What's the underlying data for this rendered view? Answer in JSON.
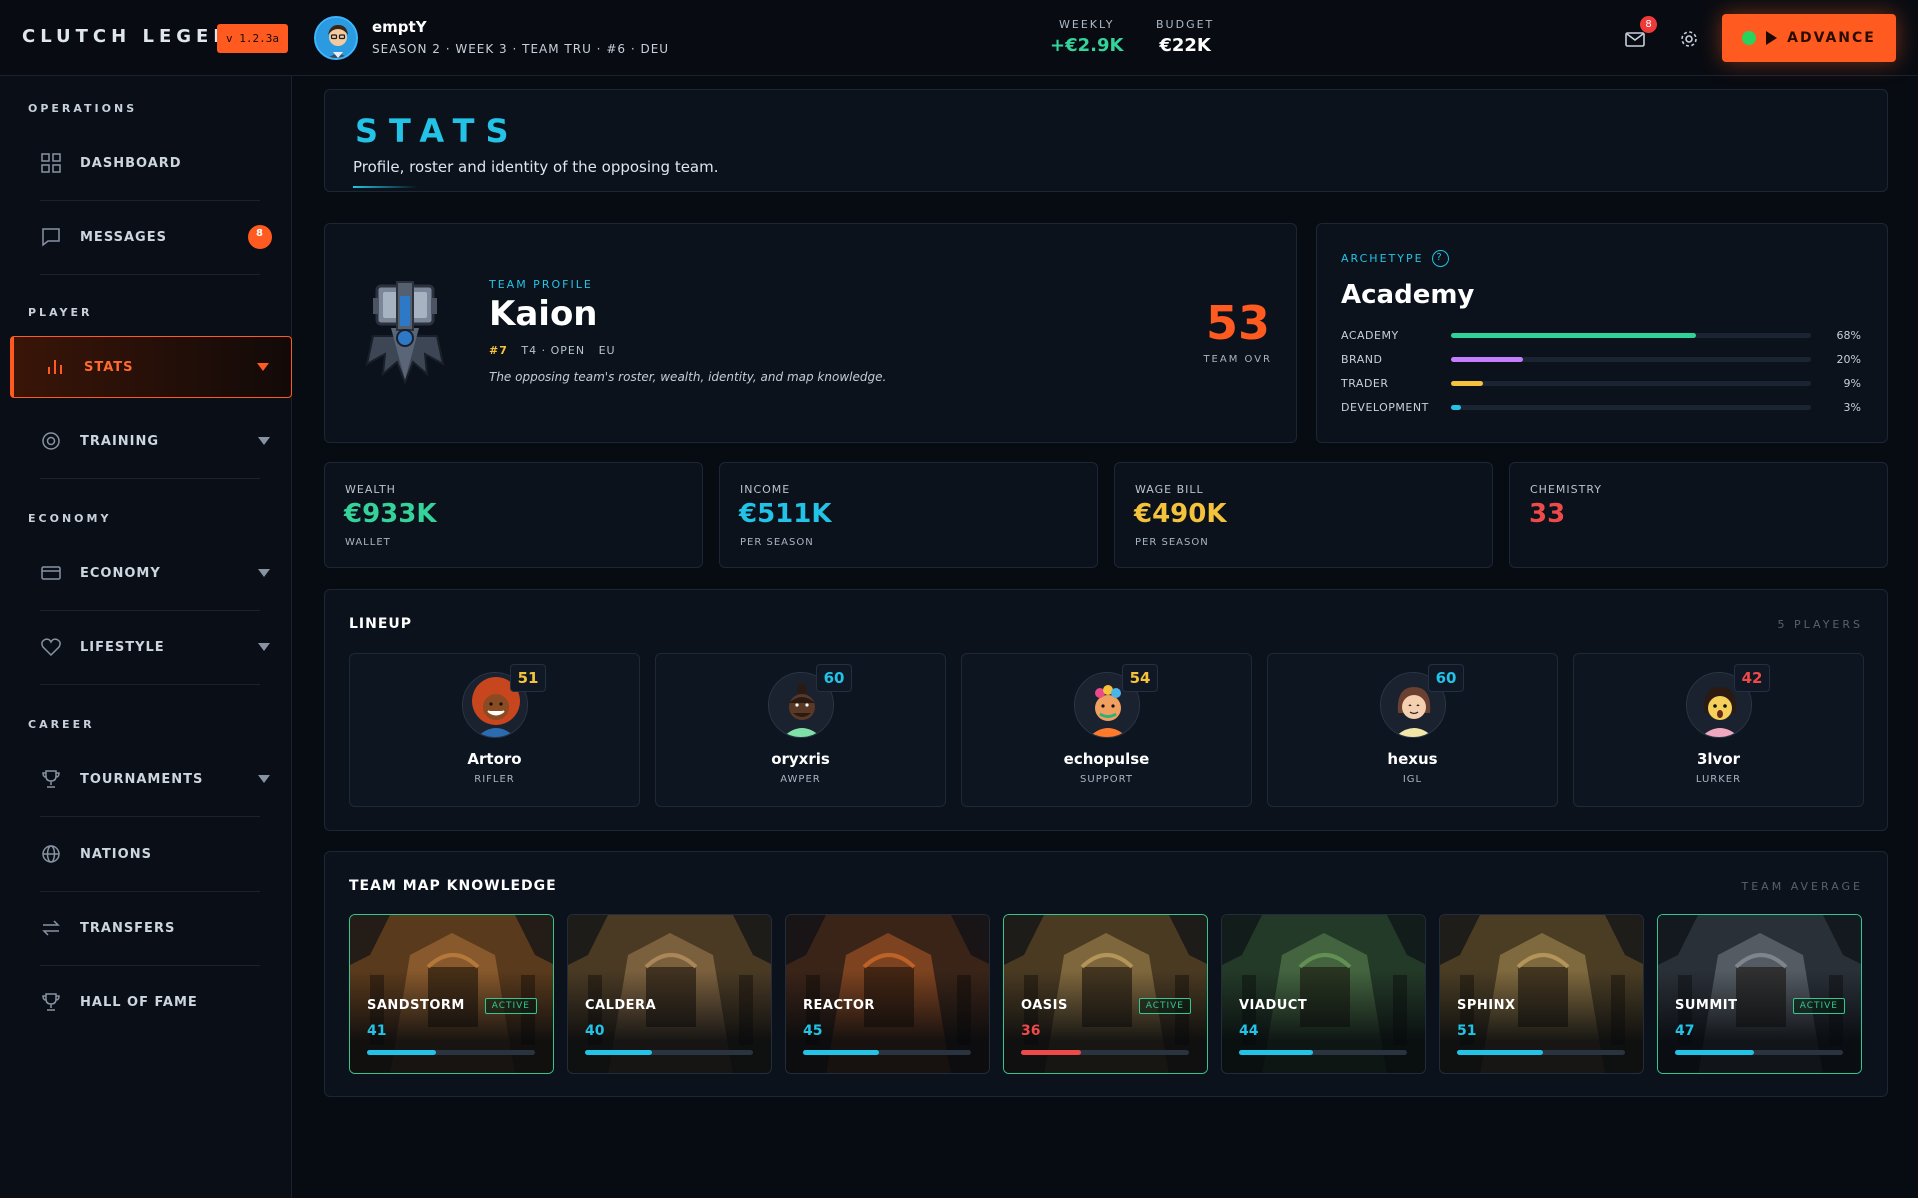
{
  "app": {
    "logo": "CLUTCH LEGEND",
    "version": "v 1.2.3a"
  },
  "user": {
    "name": "emptY",
    "subtitle": "SEASON 2 · WEEK 3 · TEAM TRU · #6 · DEU"
  },
  "topstats": {
    "weekly_label": "WEEKLY",
    "weekly_value": "+€2.9K",
    "budget_label": "BUDGET",
    "budget_value": "€22K"
  },
  "mail_badge": "8",
  "advance_label": "ADVANCE",
  "sidebar": {
    "sections": [
      "OPERATIONS",
      "PLAYER",
      "ECONOMY",
      "CAREER"
    ],
    "items": [
      {
        "label": "DASHBOARD",
        "icon": "grid-icon"
      },
      {
        "label": "MESSAGES",
        "icon": "chat-icon",
        "badge": "8"
      },
      {
        "label": "STATS",
        "icon": "bar-chart-icon",
        "active": true
      },
      {
        "label": "TRAINING",
        "icon": "target-icon"
      },
      {
        "label": "ECONOMY",
        "icon": "card-icon"
      },
      {
        "label": "LIFESTYLE",
        "icon": "heart-icon"
      },
      {
        "label": "TOURNAMENTS",
        "icon": "trophy-icon"
      },
      {
        "label": "NATIONS",
        "icon": "globe-icon"
      },
      {
        "label": "TRANSFERS",
        "icon": "swap-icon"
      },
      {
        "label": "HALL OF FAME",
        "icon": "trophy-icon"
      }
    ]
  },
  "header": {
    "title": "STATS",
    "subtitle": "Profile, roster and identity of the opposing team."
  },
  "team": {
    "label": "TEAM PROFILE",
    "name": "Kaion",
    "rank": "#7",
    "tier": "T4 · OPEN",
    "region": "EU",
    "description": "The opposing team's roster, wealth, identity, and map knowledge.",
    "ovr": "53",
    "ovr_label": "TEAM OVR"
  },
  "archetype": {
    "label": "ARCHETYPE",
    "help": "?",
    "name": "Academy",
    "rows": [
      {
        "name": "ACADEMY",
        "pct_label": "68%",
        "value": 0.68,
        "color": "#2fd39a"
      },
      {
        "name": "BRAND",
        "pct_label": "20%",
        "value": 0.2,
        "color": "#c77dff"
      },
      {
        "name": "TRADER",
        "pct_label": "9%",
        "value": 0.09,
        "color": "#f5c33b"
      },
      {
        "name": "DEVELOPMENT",
        "pct_label": "3%",
        "value": 0.03,
        "color": "#22c3e6"
      }
    ]
  },
  "kpis": [
    {
      "label": "WEALTH",
      "value": "€933K",
      "sub": "WALLET",
      "color": "#35d39a"
    },
    {
      "label": "INCOME",
      "value": "€511K",
      "sub": "PER SEASON",
      "color": "#22c3e6"
    },
    {
      "label": "WAGE BILL",
      "value": "€490K",
      "sub": "PER SEASON",
      "color": "#f5c33b"
    },
    {
      "label": "CHEMISTRY",
      "value": "33",
      "sub": "",
      "color": "#ef4a4a"
    }
  ],
  "lineup": {
    "title": "LINEUP",
    "count": "5 PLAYERS",
    "players": [
      {
        "name": "Artoro",
        "role": "RIFLER",
        "ovr": "51",
        "ovr_color": "#f5c33b",
        "avatar": "player-avatar-afro"
      },
      {
        "name": "oryxris",
        "role": "AWPER",
        "ovr": "60",
        "ovr_color": "#22c3e6",
        "avatar": "player-avatar-bun"
      },
      {
        "name": "echopulse",
        "role": "SUPPORT",
        "ovr": "54",
        "ovr_color": "#f5c33b",
        "avatar": "player-avatar-flowers"
      },
      {
        "name": "hexus",
        "role": "IGL",
        "ovr": "60",
        "ovr_color": "#22c3e6",
        "avatar": "player-avatar-bob"
      },
      {
        "name": "3lvor",
        "role": "LURKER",
        "ovr": "42",
        "ovr_color": "#ef4a4a",
        "avatar": "player-avatar-shocked"
      }
    ]
  },
  "maps": {
    "title": "TEAM MAP KNOWLEDGE",
    "right_label": "TEAM AVERAGE",
    "active_label": "ACTIVE",
    "items": [
      {
        "name": "SANDSTORM",
        "value": "41",
        "level": 41,
        "active": true,
        "color": "#22c3e6",
        "tint": "#5a3a1c"
      },
      {
        "name": "CALDERA",
        "value": "40",
        "level": 40,
        "active": false,
        "color": "#22c3e6",
        "tint": "#4a3a24"
      },
      {
        "name": "REACTOR",
        "value": "45",
        "level": 45,
        "active": false,
        "color": "#22c3e6",
        "tint": "#3a2418"
      },
      {
        "name": "OASIS",
        "value": "36",
        "level": 36,
        "active": true,
        "color": "#ef4a4a",
        "tint": "#4a3a22"
      },
      {
        "name": "VIADUCT",
        "value": "44",
        "level": 44,
        "active": false,
        "color": "#22c3e6",
        "tint": "#243a28"
      },
      {
        "name": "SPHINX",
        "value": "51",
        "level": 51,
        "active": false,
        "color": "#22c3e6",
        "tint": "#4a3d24"
      },
      {
        "name": "SUMMIT",
        "value": "47",
        "level": 47,
        "active": true,
        "color": "#22c3e6",
        "tint": "#2a3038"
      }
    ]
  }
}
